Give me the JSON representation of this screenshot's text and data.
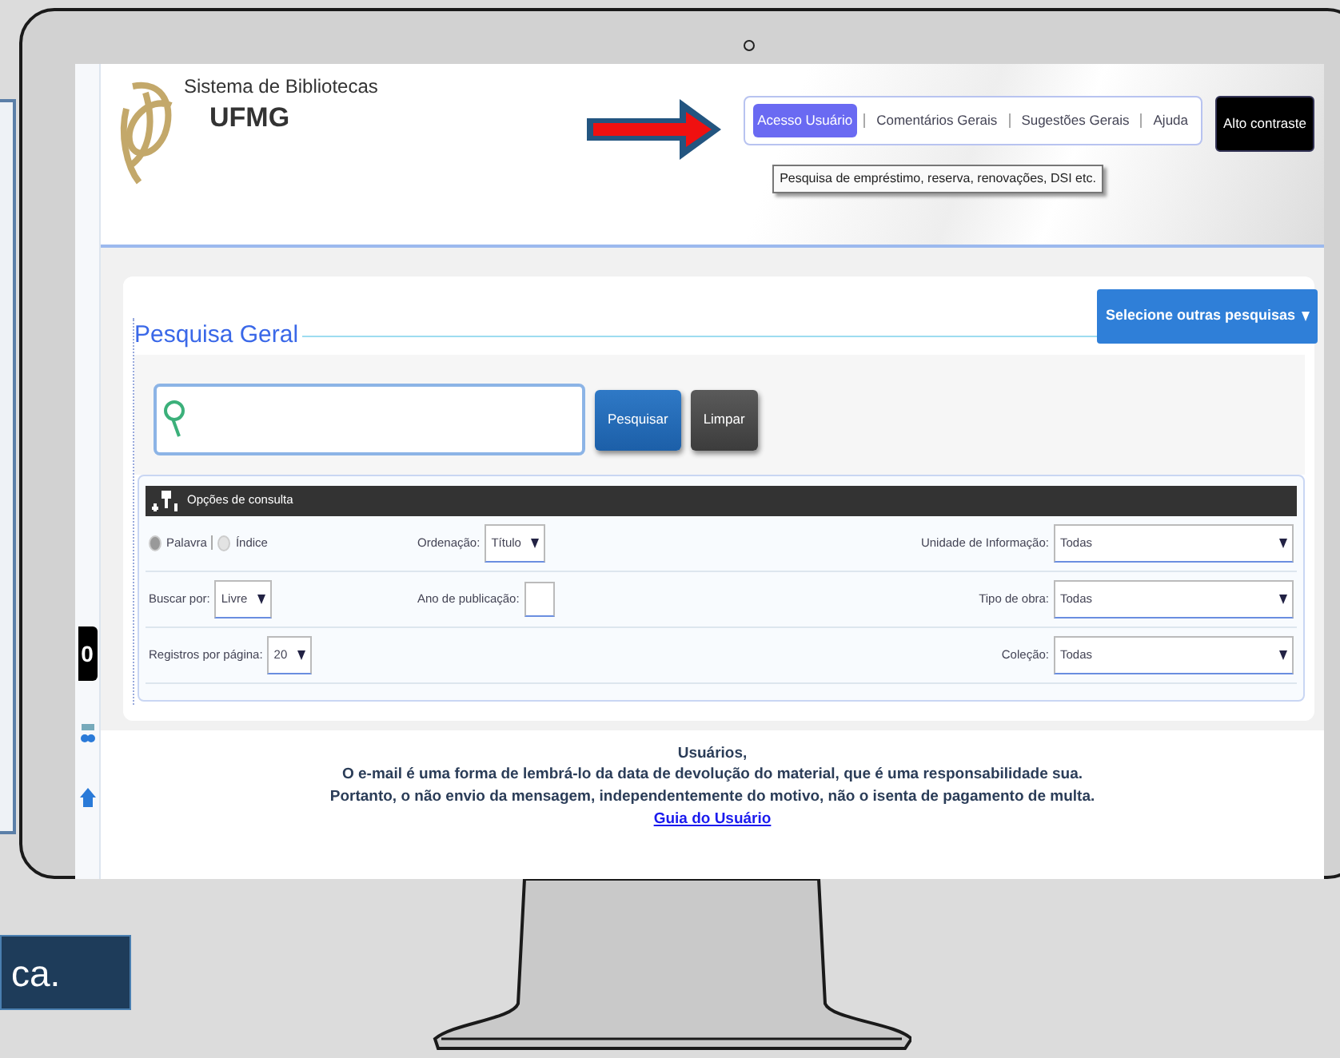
{
  "slide": {
    "caption_fragment": "ca.",
    "behind_fragment": "0"
  },
  "site": {
    "title_line1": "Sistema de Bibliotecas",
    "title_line2": "UFMG"
  },
  "nav": [
    {
      "label": "Acesso Usuário",
      "selected": true
    },
    {
      "label": "Comentários Gerais",
      "selected": false
    },
    {
      "label": "Sugestões Gerais",
      "selected": false
    },
    {
      "label": "Ajuda",
      "selected": false
    }
  ],
  "tooltip": "Pesquisa de empréstimo, reserva, renovações, DSI etc.",
  "contrast_button": "Alto contraste",
  "other_searches_button": "Selecione outras pesquisas",
  "search": {
    "legend": "Pesquisa Geral",
    "buttons": [
      {
        "label": "Pesquisar",
        "kind": "primary"
      },
      {
        "label": "Limpar",
        "kind": "secondary"
      }
    ]
  },
  "options": {
    "title": "Opções de consulta",
    "rows": [
      {
        "left": {
          "kind": "radios",
          "options": [
            {
              "label": "Palavra",
              "selected": true
            },
            {
              "label": "Índice",
              "selected": false
            }
          ]
        },
        "middle": {
          "kind": "select",
          "label": "Ordenação:",
          "value": "Título"
        },
        "right": {
          "kind": "select",
          "label": "Unidade de Informação:",
          "value": "Todas"
        }
      },
      {
        "left": {
          "kind": "select",
          "label": "Buscar por:",
          "value": "Livre"
        },
        "middle": {
          "kind": "input",
          "label": "Ano de publicação:"
        },
        "right": {
          "kind": "select",
          "label": "Tipo de obra:",
          "value": "Todas"
        }
      },
      {
        "left": {
          "kind": "select",
          "label": "Registros por página:",
          "value": "20"
        },
        "right": {
          "kind": "select",
          "label": "Coleção:",
          "value": "Todas"
        }
      }
    ]
  },
  "footer": {
    "lines": [
      "Usuários,",
      "O e-mail é uma forma de lembrá-lo da data de devolução do material, que é uma responsabilidade sua.",
      "Portanto, o não envio da mensagem, independentemente do motivo, não o isenta de pagamento de multa."
    ],
    "link": "Guia do Usuário"
  }
}
